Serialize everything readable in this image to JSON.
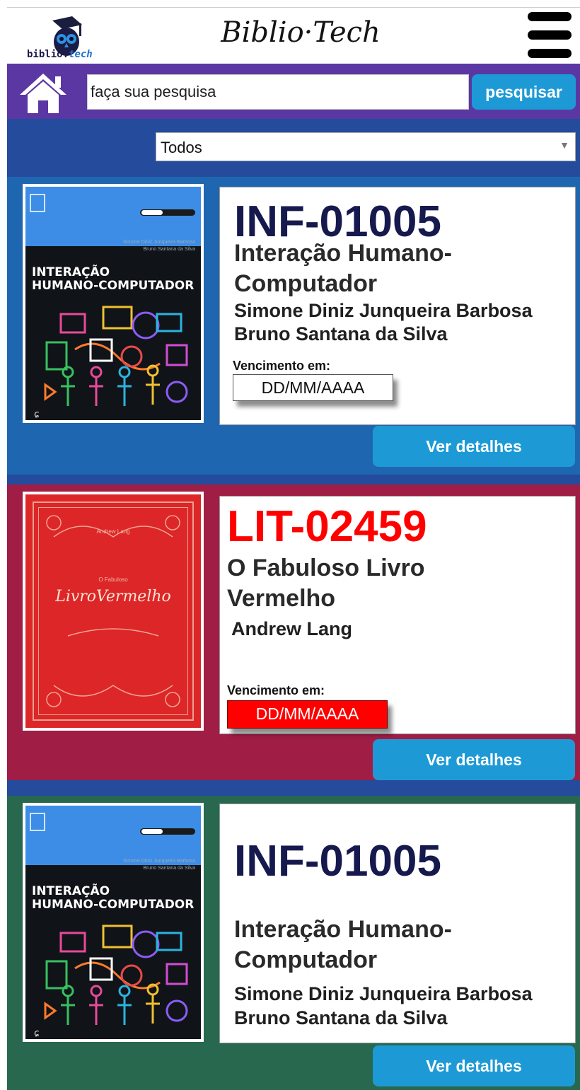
{
  "header": {
    "logo_text_a": "biblio.",
    "logo_text_b": "tech",
    "app_title": "Biblio·Tech",
    "menu_icon": "hamburger-menu-icon"
  },
  "search": {
    "home_icon": "home-icon",
    "placeholder": "faça sua pesquisa",
    "button_label": "pesquisar"
  },
  "filter": {
    "selected": "Todos",
    "caret_icon": "chevron-down-icon"
  },
  "colors": {
    "header_bg": "#ffffff",
    "search_bar": "#5b37a3",
    "filter_bar": "#244b9c",
    "card_blue": "#1f66b1",
    "card_wine": "#a01d45",
    "card_green": "#27684f",
    "button": "#1d9ad6",
    "code_dark": "#16194d",
    "code_red": "#ff0000",
    "due_red": "#ff0000"
  },
  "cards": [
    {
      "code": "INF-01005",
      "title_line1": "Interação Humano-",
      "title_line2": "Computador",
      "author1": "Simone Diniz Junqueira Barbosa",
      "author2": "Bruno Santana da Silva",
      "due_label": "Vencimento em:",
      "due_value": "DD/MM/AAAA",
      "button": "Ver detalhes",
      "cover": {
        "title_line1": "INTERAÇÃO",
        "title_line2": "HUMANO-COMPUTADOR",
        "authors_line1": "Simone Diniz Junqueira Barbosa",
        "authors_line2": "Bruno Santana da Silva"
      }
    },
    {
      "code": "LIT-02459",
      "title_line1": "O Fabuloso Livro",
      "title_line2": "Vermelho",
      "author1": "Andrew Lang",
      "due_label": "Vencimento em:",
      "due_value": "DD/MM/AAAA",
      "button": "Ver detalhes",
      "cover": {
        "author": "Andrew Lang",
        "pre_title": "O Fabuloso",
        "title": "LivroVermelho"
      }
    },
    {
      "code": "INF-01005",
      "title_line1": "Interação Humano-",
      "title_line2": "Computador",
      "author1": "Simone Diniz Junqueira Barbosa",
      "author2": "Bruno Santana da Silva",
      "button": "Ver detalhes",
      "cover": {
        "title_line1": "INTERAÇÃO",
        "title_line2": "HUMANO-COMPUTADOR",
        "authors_line1": "Simone Diniz Junqueira Barbosa",
        "authors_line2": "Bruno Santana da Silva"
      }
    }
  ]
}
